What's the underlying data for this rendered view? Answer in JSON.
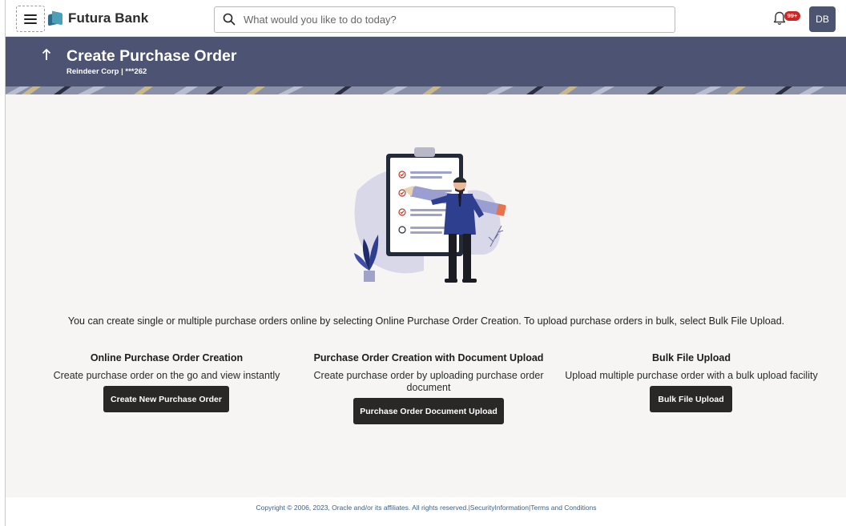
{
  "header": {
    "brand": "Futura Bank",
    "search_placeholder": "What would you like to do today?",
    "notification_count": "99+",
    "avatar_initials": "DB"
  },
  "banner": {
    "back_icon": "arrow-up-icon",
    "title": "Create Purchase Order",
    "subtitle": "Reindeer Corp | ***262"
  },
  "main": {
    "intro": "You can create single or multiple purchase orders online by selecting Online Purchase Order Creation. To upload purchase orders in bulk, select Bulk File Upload.",
    "options": [
      {
        "title": "Online Purchase Order Creation",
        "description": "Create purchase order on the go and view instantly",
        "button": "Create New Purchase Order"
      },
      {
        "title": "Purchase Order Creation with Document Upload",
        "description": "Create purchase order by uploading purchase order document",
        "button": "Purchase Order Document Upload"
      },
      {
        "title": "Bulk File Upload",
        "description": "Upload multiple purchase order with a bulk upload facility",
        "button": "Bulk File Upload"
      }
    ]
  },
  "footer": {
    "copyright": "Copyright © 2006, 2023, Oracle and/or its affiliates. All rights reserved.",
    "security": "SecurityInformation",
    "terms": "Terms and Conditions"
  },
  "colors": {
    "banner": "#4d5372",
    "button": "#2a2727",
    "avatar": "#4c5470",
    "badge": "#c62828",
    "link": "#3a5f85"
  }
}
